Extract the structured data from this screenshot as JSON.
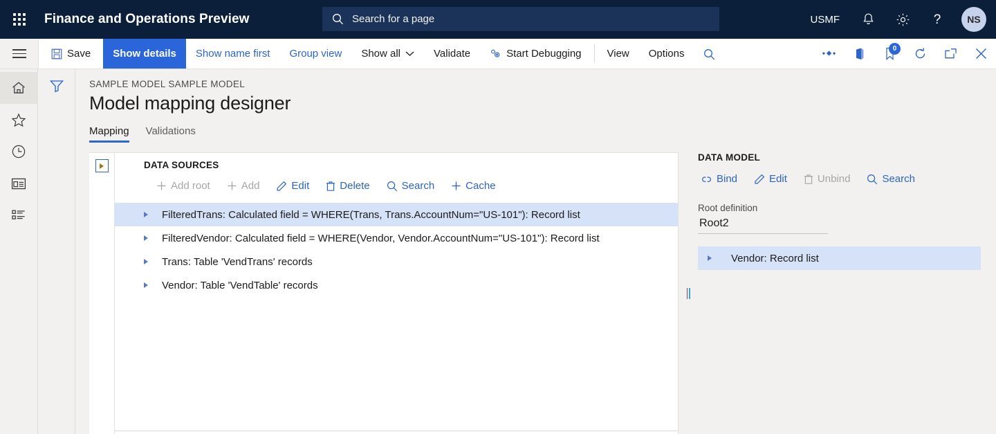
{
  "topnav": {
    "waffle_label": "app-launcher",
    "app_title": "Finance and Operations Preview",
    "search_placeholder": "Search for a page",
    "company": "USMF",
    "avatar_initials": "NS",
    "bg_color": "#0b1f3b",
    "search_bg_color": "#1b3259"
  },
  "toolbar": {
    "save_label": "Save",
    "show_details_label": "Show details",
    "show_name_first_label": "Show name first",
    "group_view_label": "Group view",
    "show_all_label": "Show all",
    "validate_label": "Validate",
    "start_debugging_label": "Start Debugging",
    "view_label": "View",
    "options_label": "Options",
    "notification_count": "0",
    "accent_color": "#2a66d9",
    "link_color": "#2c64c6"
  },
  "rail": {
    "items": [
      {
        "name": "home",
        "label": "Home"
      },
      {
        "name": "favorites",
        "label": "Favorites"
      },
      {
        "name": "recent",
        "label": "Recent"
      },
      {
        "name": "workspaces",
        "label": "Workspaces"
      },
      {
        "name": "modules",
        "label": "Modules"
      }
    ]
  },
  "page": {
    "breadcrumb": "SAMPLE MODEL SAMPLE MODEL",
    "title": "Model mapping designer",
    "tabs": [
      {
        "label": "Mapping",
        "selected": true
      },
      {
        "label": "Validations",
        "selected": false
      }
    ]
  },
  "data_sources": {
    "heading": "DATA SOURCES",
    "actions": [
      {
        "label": "Add root",
        "icon": "plus-icon",
        "disabled": true
      },
      {
        "label": "Add",
        "icon": "plus-icon",
        "disabled": true
      },
      {
        "label": "Edit",
        "icon": "pencil-icon",
        "disabled": false
      },
      {
        "label": "Delete",
        "icon": "trash-icon",
        "disabled": false
      },
      {
        "label": "Search",
        "icon": "search-icon",
        "disabled": false
      },
      {
        "label": "Cache",
        "icon": "plus-icon",
        "disabled": false
      }
    ],
    "tree": [
      {
        "label": "FilteredTrans: Calculated field = WHERE(Trans, Trans.AccountNum=\"US-101\"): Record list",
        "selected": true
      },
      {
        "label": "FilteredVendor: Calculated field = WHERE(Vendor, Vendor.AccountNum=\"US-101\"): Record list",
        "selected": false
      },
      {
        "label": "Trans: Table 'VendTrans' records",
        "selected": false
      },
      {
        "label": "Vendor: Table 'VendTable' records",
        "selected": false
      }
    ]
  },
  "data_model": {
    "heading": "DATA MODEL",
    "actions": [
      {
        "label": "Bind",
        "icon": "link-icon",
        "disabled": false
      },
      {
        "label": "Edit",
        "icon": "pencil-icon",
        "disabled": false
      },
      {
        "label": "Unbind",
        "icon": "trash-icon",
        "disabled": true
      },
      {
        "label": "Search",
        "icon": "search-icon",
        "disabled": false
      }
    ],
    "root_definition_label": "Root definition",
    "root_definition_value": "Root2",
    "tree": [
      {
        "label": "Vendor: Record list",
        "selected": true
      }
    ]
  },
  "colors": {
    "selection_blue": "#d6e2f7",
    "page_bg": "#f2f1ef",
    "pane_bg": "#ffffff"
  }
}
